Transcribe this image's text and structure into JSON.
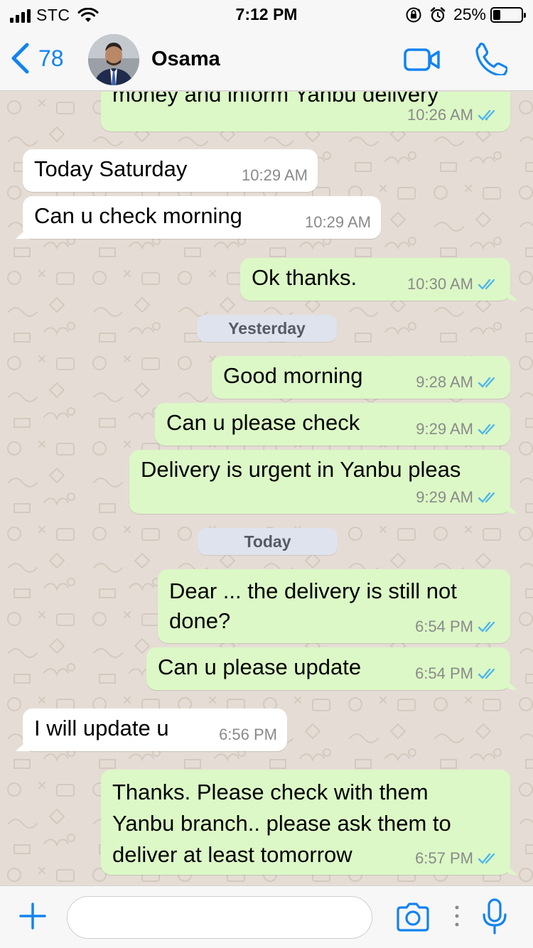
{
  "status_bar": {
    "carrier": "STC",
    "time": "7:12 PM",
    "battery_percent": "25%",
    "battery_level": 0.25,
    "icons": [
      "signal-icon",
      "wifi-icon",
      "rotation-lock-icon",
      "alarm-icon",
      "battery-icon"
    ]
  },
  "header": {
    "back_count": "78",
    "contact_name": "Osama",
    "icons": [
      "chevron-left-icon",
      "video-call-icon",
      "phone-icon"
    ]
  },
  "colors": {
    "accent": "#1283f0",
    "outgoing_bubble": "#dcf8c6",
    "incoming_bubble": "#ffffff",
    "read_ticks": "#4fb6ec",
    "chat_background": "#e5ddd5"
  },
  "messages": [
    {
      "direction": "out",
      "text": "money and inform Yanbu delivery",
      "time": "10:26 AM",
      "read": true
    },
    {
      "direction": "in",
      "text": "Today Saturday",
      "time": "10:29 AM"
    },
    {
      "direction": "in",
      "text": "Can u check morning",
      "time": "10:29 AM"
    },
    {
      "direction": "out",
      "text": "Ok thanks.",
      "time": "10:30 AM",
      "read": true
    },
    {
      "type": "date",
      "label": "Yesterday"
    },
    {
      "direction": "out",
      "text": "Good morning",
      "time": "9:28 AM",
      "read": true
    },
    {
      "direction": "out",
      "text": "Can u please check",
      "time": "9:29 AM",
      "read": true
    },
    {
      "direction": "out",
      "text": "Delivery is urgent in Yanbu pleas",
      "time": "9:29 AM",
      "read": true
    },
    {
      "type": "date",
      "label": "Today"
    },
    {
      "direction": "out",
      "text": "Dear ... the delivery is still not\ndone?",
      "time": "6:54 PM",
      "read": true
    },
    {
      "direction": "out",
      "text": "Can u please update",
      "time": "6:54 PM",
      "read": true
    },
    {
      "direction": "in",
      "text": "I will update u",
      "time": "6:56 PM"
    },
    {
      "direction": "out",
      "text": "Thanks. Please check with them\nYanbu branch.. please ask them to\ndeliver at least tomorrow",
      "time": "6:57 PM",
      "read": true
    }
  ],
  "input_bar": {
    "placeholder": "",
    "icons": [
      "plus-icon",
      "camera-icon",
      "more-dots-icon",
      "microphone-icon"
    ]
  }
}
